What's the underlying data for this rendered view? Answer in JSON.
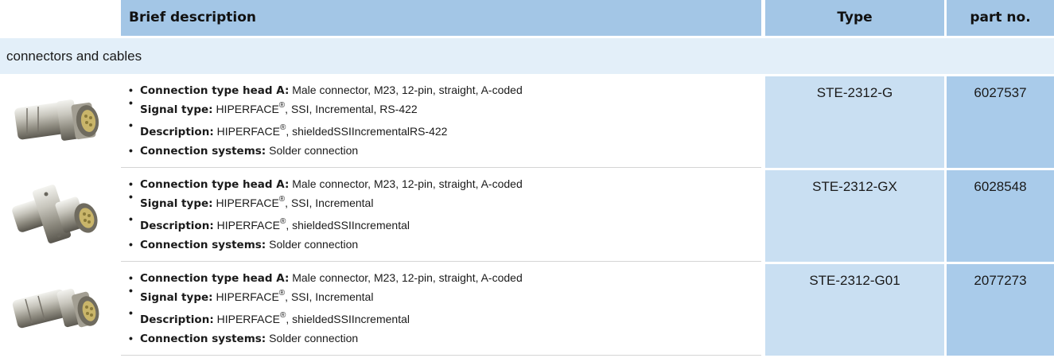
{
  "header": {
    "desc": "Brief description",
    "type": "Type",
    "part": "part no."
  },
  "section": "connectors and cables",
  "rows": [
    {
      "image_icon": "m23-straight-connector-photo",
      "type": "STE-2312-G",
      "part": "6027537",
      "bullets": [
        {
          "label": "Connection type head A:",
          "value": "Male connector, M23, 12-pin, straight, A-coded"
        },
        {
          "label": "Signal type:",
          "pre": "HIPERFACE",
          "sup": "®",
          "post": ", SSI, Incremental, RS-422"
        },
        {
          "label": "Description:",
          "pre": "HIPERFACE",
          "sup": "®",
          "post": ", shieldedSSIIncrementalRS-422"
        },
        {
          "label": "Connection systems:",
          "value": "Solder connection"
        }
      ]
    },
    {
      "image_icon": "m23-flange-connector-photo",
      "type": "STE-2312-GX",
      "part": "6028548",
      "bullets": [
        {
          "label": "Connection type head A:",
          "value": "Male connector, M23, 12-pin, straight, A-coded"
        },
        {
          "label": "Signal type:",
          "pre": "HIPERFACE",
          "sup": "®",
          "post": ", SSI, Incremental"
        },
        {
          "label": "Description:",
          "pre": "HIPERFACE",
          "sup": "®",
          "post": ", shieldedSSIIncremental"
        },
        {
          "label": "Connection systems:",
          "value": "Solder connection"
        }
      ]
    },
    {
      "image_icon": "m23-straight-connector-photo",
      "type": "STE-2312-G01",
      "part": "2077273",
      "bullets": [
        {
          "label": "Connection type head A:",
          "value": "Male connector, M23, 12-pin, straight, A-coded"
        },
        {
          "label": "Signal type:",
          "pre": "HIPERFACE",
          "sup": "®",
          "post": ", SSI, Incremental"
        },
        {
          "label": "Description:",
          "pre": "HIPERFACE",
          "sup": "®",
          "post": ", shieldedSSIIncremental"
        },
        {
          "label": "Connection systems:",
          "value": "Solder connection"
        }
      ]
    }
  ],
  "colors": {
    "header_bg": "#a3c6e6",
    "section_bg": "#e3eff9",
    "type_bg": "#c9dff2",
    "part_bg": "#a9cbea"
  }
}
